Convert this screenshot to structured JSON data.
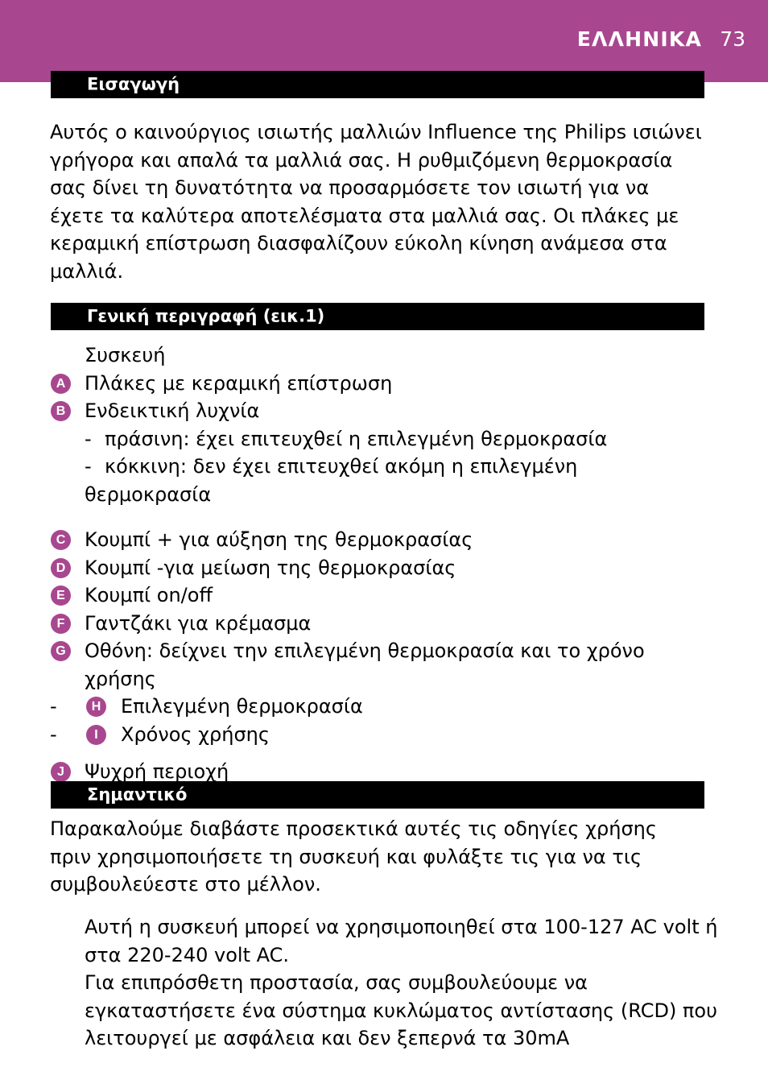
{
  "header": {
    "language_title": "ΕΛΛΗΝΙΚΑ",
    "page_number": "73",
    "band_color": "#a8478f"
  },
  "sections": {
    "intro": {
      "heading": "Εισαγωγή",
      "paragraph": "Αυτός ο καινούργιος ισιωτής μαλλιών Influence της Philips ισιώνει γρήγορα και απαλά τα μαλλιά σας. Η ρυθμιζόμενη θερμοκρασία σας δίνει τη δυνατότητα να προσαρμόσετε τον ισιωτή για να έχετε τα καλύτερα αποτελέσματα στα μαλλιά σας. Οι πλάκες με κεραμική επίστρωση διασφαλίζουν εύκολη κίνηση ανάμεσα στα μαλλιά."
    },
    "general": {
      "heading": "Γενική περιγραφή (εικ.1)",
      "device_label": "Συσκευή",
      "items": [
        {
          "badge": "A",
          "label": "Πλάκες με κεραμική επίστρωση"
        },
        {
          "badge": "B",
          "label": "Ενδεικτική λυχνία"
        }
      ],
      "light_states": [
        {
          "dash": "-",
          "label": "πράσινη: έχει επιτευχθεί η επιλεγμένη θερμοκρασία"
        },
        {
          "dash": "-",
          "label": "κόκκινη: δεν έχει επιτευχθεί ακόμη η επιλεγμένη",
          "continuation": "θερμοκρασία"
        }
      ],
      "items2": [
        {
          "badge": "C",
          "label": "Κουμπί + για αύξηση της θερμοκρασίας"
        },
        {
          "badge": "D",
          "label": "Κουμπί -για μείωση της θερμοκρασίας"
        },
        {
          "badge": "E",
          "label": "Κουμπί on/off"
        },
        {
          "badge": "F",
          "label": "Γαντζάκι για κρέμασμα"
        }
      ],
      "display_item": {
        "badge": "G",
        "label_line1": "Οθόνη: δείχνει την επιλεγμένη θερμοκρασία και το χρόνο",
        "label_line2": "χρήσης"
      },
      "display_sub_items": [
        {
          "dash": "-",
          "badge": "H",
          "label": "Επιλεγμένη θερμοκρασία"
        },
        {
          "dash": "-",
          "badge": "I",
          "label": "Χρόνος χρήσης"
        }
      ],
      "items3": [
        {
          "badge": "J",
          "label": "Ψυχρή περιοχή"
        }
      ]
    },
    "important": {
      "heading": "Σημαντικό",
      "paragraph": "Παρακαλούμε διαβάστε προσεκτικά αυτές τις οδηγίες χρήσης πριν χρησιμοποιήσετε τη συσκευή και φυλάξτε τις για να τις συμβουλεύεστε στο μέλλον.",
      "voltage_paragraph": "Αυτή η συσκευή μπορεί να χρησιμοποιηθεί στα 100-127 AC volt ή στα 220-240 volt AC.",
      "rcd_paragraph": "Για επιπρόσθετη προστασία, σας συμβουλεύουμε να εγκαταστήσετε ένα σύστημα κυκλώματος αντίστασης (RCD) που λειτουργεί με ασφάλεια και δεν ξεπερνά τα 30mA"
    }
  }
}
